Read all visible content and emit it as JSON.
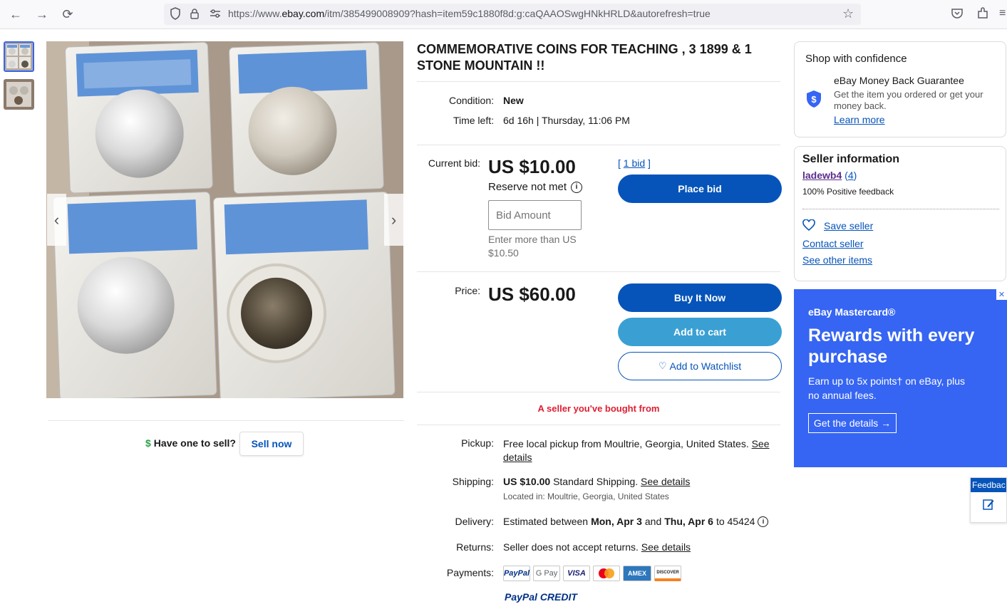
{
  "browser": {
    "url_prefix": "https://www.",
    "url_domain": "ebay.com",
    "url_rest": "/itm/385499008909?hash=item59c1880f8d:g:caQAAOSwgHNkHRLD&autorefresh=true"
  },
  "listing": {
    "title": "COMMEMORATIVE COINS FOR TEACHING , 3 1899 & 1 STONE MOUNTAIN !!",
    "condition_label": "Condition:",
    "condition_value": "New",
    "time_left_label": "Time left:",
    "time_left_value": "6d 16h | Thursday, 11:06 PM",
    "current_bid_label": "Current bid:",
    "current_bid_value": "US $10.00",
    "bid_count": "1 bid",
    "reserve_text": "Reserve not met",
    "bid_placeholder": "Bid Amount",
    "bid_hint": "Enter more than US $10.50",
    "place_bid": "Place bid",
    "price_label": "Price:",
    "price_value": "US $60.00",
    "buy_it_now": "Buy It Now",
    "add_to_cart": "Add to cart",
    "add_to_watchlist": "Add to Watchlist",
    "seller_note": "A seller you've bought from"
  },
  "sell": {
    "prompt": "Have one to sell?",
    "button": "Sell now"
  },
  "shipping": {
    "pickup_label": "Pickup:",
    "pickup_text": "Free local pickup from Moultrie, Georgia, United States.",
    "pickup_link": "See details",
    "shipping_label": "Shipping:",
    "shipping_price": "US $10.00",
    "shipping_type": "Standard Shipping.",
    "shipping_link": "See details",
    "located": "Located in: Moultrie, Georgia, United States",
    "delivery_label": "Delivery:",
    "delivery_pre": "Estimated between",
    "delivery_date1": "Mon, Apr 3",
    "delivery_and": "and",
    "delivery_date2": "Thu, Apr 6",
    "delivery_post": "to 45424",
    "returns_label": "Returns:",
    "returns_text": "Seller does not accept returns.",
    "returns_link": "See details",
    "payments_label": "Payments:",
    "payments": [
      "PayPal",
      "G Pay",
      "VISA",
      "",
      "AMEX",
      "DISCOVER"
    ],
    "paypal_credit": "PayPal CREDIT"
  },
  "confidence": {
    "heading": "Shop with confidence",
    "guarantee_title": "eBay Money Back Guarantee",
    "guarantee_text": "Get the item you ordered or get your money back.",
    "learn_more": "Learn more"
  },
  "seller": {
    "heading": "Seller information",
    "name": "ladewb4",
    "feedback_count": "4",
    "positive": "100% Positive feedback",
    "save_seller": "Save seller",
    "contact_seller": "Contact seller",
    "other_items": "See other items"
  },
  "ad": {
    "brand": "eBay Mastercard®",
    "headline": "Rewards with every purchase",
    "body": "Earn up to 5x points† on eBay, plus no annual fees.",
    "cta": "Get the details →",
    "close": "✕"
  },
  "feedback_tab": "Feedbac",
  "colors": {
    "ebay_blue": "#0654ba",
    "ad_blue": "#3665f3",
    "alert_red": "#dd1e31"
  }
}
